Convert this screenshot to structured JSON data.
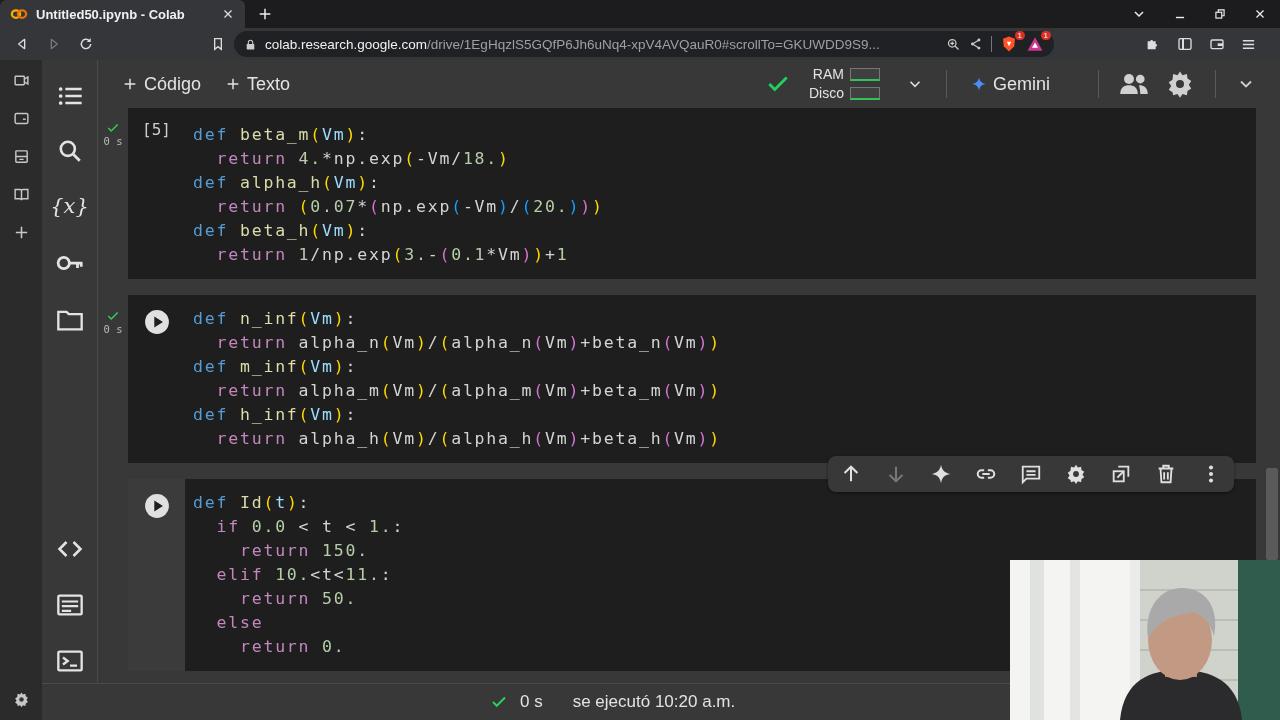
{
  "browser": {
    "tab_title": "Untitled50.ipynb - Colab",
    "url_host": "colab.research.google.com",
    "url_path": "/drive/1EgHqzlS5GQfP6Jh6uNq4-xpV4AVQauR0#scrollTo=GKUWDD9S9...",
    "extension_badges": [
      "1",
      "1"
    ]
  },
  "sidebar": {
    "variables_label": "{x}"
  },
  "toolbar": {
    "add_buttons": [
      "Código",
      "Texto"
    ],
    "connected": true,
    "ram_label": "RAM",
    "disk_label": "Disco",
    "gemini_label": "Gemini"
  },
  "cells": [
    {
      "count": "[5]",
      "done": true,
      "time": "0 s",
      "selected": false,
      "lines": [
        [
          {
            "text": "def ",
            "kind": "d"
          },
          {
            "text": "beta_m",
            "kind": "n"
          },
          {
            "text": "(",
            "kind": "y"
          },
          {
            "text": "Vm",
            "kind": "v"
          },
          {
            "text": ")",
            "kind": "y"
          },
          {
            "text": ":",
            "kind": "t"
          }
        ],
        [
          {
            "text": "  return ",
            "kind": "k"
          },
          {
            "text": "4.",
            "kind": "num"
          },
          {
            "text": "*np.exp",
            "kind": "t"
          },
          {
            "text": "(",
            "kind": "y"
          },
          {
            "text": "-Vm/",
            "kind": "t"
          },
          {
            "text": "18.",
            "kind": "num"
          },
          {
            "text": ")",
            "kind": "y"
          }
        ],
        [
          {
            "text": "def ",
            "kind": "d"
          },
          {
            "text": "alpha_h",
            "kind": "n"
          },
          {
            "text": "(",
            "kind": "y"
          },
          {
            "text": "Vm",
            "kind": "v"
          },
          {
            "text": ")",
            "kind": "y"
          },
          {
            "text": ":",
            "kind": "t"
          }
        ],
        [
          {
            "text": "  return ",
            "kind": "k"
          },
          {
            "text": "(",
            "kind": "y"
          },
          {
            "text": "0.07",
            "kind": "num"
          },
          {
            "text": "*",
            "kind": "t"
          },
          {
            "text": "(",
            "kind": "m"
          },
          {
            "text": "np.exp",
            "kind": "t"
          },
          {
            "text": "(",
            "kind": "b"
          },
          {
            "text": "-Vm",
            "kind": "t"
          },
          {
            "text": ")",
            "kind": "b"
          },
          {
            "text": "/",
            "kind": "t"
          },
          {
            "text": "(",
            "kind": "b"
          },
          {
            "text": "20.",
            "kind": "num"
          },
          {
            "text": ")",
            "kind": "b"
          },
          {
            "text": ")",
            "kind": "m"
          },
          {
            "text": ")",
            "kind": "y"
          }
        ],
        [
          {
            "text": "def ",
            "kind": "d"
          },
          {
            "text": "beta_h",
            "kind": "n"
          },
          {
            "text": "(",
            "kind": "y"
          },
          {
            "text": "Vm",
            "kind": "v"
          },
          {
            "text": ")",
            "kind": "y"
          },
          {
            "text": ":",
            "kind": "t"
          }
        ],
        [
          {
            "text": "  return ",
            "kind": "k"
          },
          {
            "text": "1",
            "kind": "num"
          },
          {
            "text": "/np.exp",
            "kind": "t"
          },
          {
            "text": "(",
            "kind": "y"
          },
          {
            "text": "3.",
            "kind": "num"
          },
          {
            "text": "-",
            "kind": "t"
          },
          {
            "text": "(",
            "kind": "m"
          },
          {
            "text": "0.1",
            "kind": "num"
          },
          {
            "text": "*Vm",
            "kind": "t"
          },
          {
            "text": ")",
            "kind": "m"
          },
          {
            "text": ")",
            "kind": "y"
          },
          {
            "text": "+",
            "kind": "t"
          },
          {
            "text": "1",
            "kind": "num"
          }
        ]
      ]
    },
    {
      "done": true,
      "time": "0 s",
      "selected": false,
      "lines": [
        [
          {
            "text": "def ",
            "kind": "d"
          },
          {
            "text": "n_inf",
            "kind": "n"
          },
          {
            "text": "(",
            "kind": "y"
          },
          {
            "text": "Vm",
            "kind": "v"
          },
          {
            "text": ")",
            "kind": "y"
          },
          {
            "text": ":",
            "kind": "t"
          }
        ],
        [
          {
            "text": "  return ",
            "kind": "k"
          },
          {
            "text": "alpha_n",
            "kind": "t"
          },
          {
            "text": "(",
            "kind": "y"
          },
          {
            "text": "Vm",
            "kind": "t"
          },
          {
            "text": ")",
            "kind": "y"
          },
          {
            "text": "/",
            "kind": "t"
          },
          {
            "text": "(",
            "kind": "y"
          },
          {
            "text": "alpha_n",
            "kind": "t"
          },
          {
            "text": "(",
            "kind": "m"
          },
          {
            "text": "Vm",
            "kind": "t"
          },
          {
            "text": ")",
            "kind": "m"
          },
          {
            "text": "+beta_n",
            "kind": "t"
          },
          {
            "text": "(",
            "kind": "m"
          },
          {
            "text": "Vm",
            "kind": "t"
          },
          {
            "text": ")",
            "kind": "m"
          },
          {
            "text": ")",
            "kind": "y"
          }
        ],
        [
          {
            "text": "def ",
            "kind": "d"
          },
          {
            "text": "m_inf",
            "kind": "n"
          },
          {
            "text": "(",
            "kind": "y"
          },
          {
            "text": "Vm",
            "kind": "v"
          },
          {
            "text": ")",
            "kind": "y"
          },
          {
            "text": ":",
            "kind": "t"
          }
        ],
        [
          {
            "text": "  return ",
            "kind": "k"
          },
          {
            "text": "alpha_m",
            "kind": "t"
          },
          {
            "text": "(",
            "kind": "y"
          },
          {
            "text": "Vm",
            "kind": "t"
          },
          {
            "text": ")",
            "kind": "y"
          },
          {
            "text": "/",
            "kind": "t"
          },
          {
            "text": "(",
            "kind": "y"
          },
          {
            "text": "alpha_m",
            "kind": "t"
          },
          {
            "text": "(",
            "kind": "m"
          },
          {
            "text": "Vm",
            "kind": "t"
          },
          {
            "text": ")",
            "kind": "m"
          },
          {
            "text": "+beta_m",
            "kind": "t"
          },
          {
            "text": "(",
            "kind": "m"
          },
          {
            "text": "Vm",
            "kind": "t"
          },
          {
            "text": ")",
            "kind": "m"
          },
          {
            "text": ")",
            "kind": "y"
          }
        ],
        [
          {
            "text": "def ",
            "kind": "d"
          },
          {
            "text": "h_inf",
            "kind": "n"
          },
          {
            "text": "(",
            "kind": "y"
          },
          {
            "text": "Vm",
            "kind": "v"
          },
          {
            "text": ")",
            "kind": "y"
          },
          {
            "text": ":",
            "kind": "t"
          }
        ],
        [
          {
            "text": "  return ",
            "kind": "k"
          },
          {
            "text": "alpha_h",
            "kind": "t"
          },
          {
            "text": "(",
            "kind": "y"
          },
          {
            "text": "Vm",
            "kind": "t"
          },
          {
            "text": ")",
            "kind": "y"
          },
          {
            "text": "/",
            "kind": "t"
          },
          {
            "text": "(",
            "kind": "y"
          },
          {
            "text": "alpha_h",
            "kind": "t"
          },
          {
            "text": "(",
            "kind": "m"
          },
          {
            "text": "Vm",
            "kind": "t"
          },
          {
            "text": ")",
            "kind": "m"
          },
          {
            "text": "+beta_h",
            "kind": "t"
          },
          {
            "text": "(",
            "kind": "m"
          },
          {
            "text": "Vm",
            "kind": "t"
          },
          {
            "text": ")",
            "kind": "m"
          },
          {
            "text": ")",
            "kind": "y"
          }
        ]
      ]
    },
    {
      "done": false,
      "selected": true,
      "move_down_disabled": true,
      "lines": [
        [
          {
            "text": "def ",
            "kind": "d"
          },
          {
            "text": "Id",
            "kind": "n"
          },
          {
            "text": "(",
            "kind": "y"
          },
          {
            "text": "t",
            "kind": "v"
          },
          {
            "text": ")",
            "kind": "y"
          },
          {
            "text": ":",
            "kind": "t"
          }
        ],
        [
          {
            "text": "  if ",
            "kind": "k"
          },
          {
            "text": "0.0",
            "kind": "num"
          },
          {
            "text": " < t < ",
            "kind": "t"
          },
          {
            "text": "1.",
            "kind": "num"
          },
          {
            "text": ":",
            "kind": "t"
          }
        ],
        [
          {
            "text": "    return ",
            "kind": "k"
          },
          {
            "text": "150.",
            "kind": "num"
          }
        ],
        [
          {
            "text": "  elif ",
            "kind": "k"
          },
          {
            "text": "10.",
            "kind": "num"
          },
          {
            "text": "<t<",
            "kind": "t"
          },
          {
            "text": "11.",
            "kind": "num"
          },
          {
            "text": ":",
            "kind": "t"
          }
        ],
        [
          {
            "text": "    return ",
            "kind": "k"
          },
          {
            "text": "50.",
            "kind": "num"
          }
        ],
        [
          {
            "text": "  else",
            "kind": "k"
          }
        ],
        [
          {
            "text": "    return ",
            "kind": "k"
          },
          {
            "text": "0.",
            "kind": "num"
          }
        ]
      ]
    }
  ],
  "status_bar": {
    "done": true,
    "time": "0 s",
    "message": "se ejecutó 10:20 a.m."
  }
}
